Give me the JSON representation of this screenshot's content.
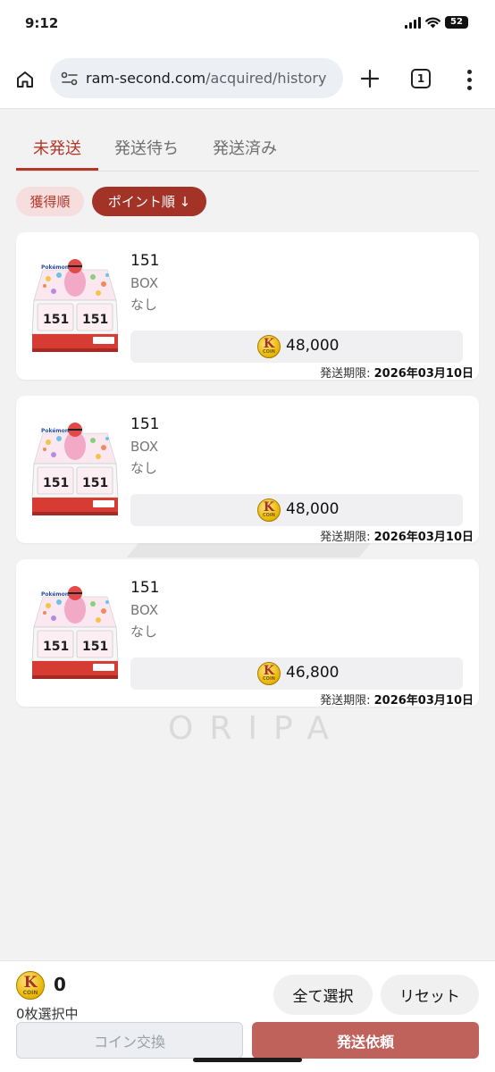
{
  "status_bar": {
    "time": "9:12",
    "battery": "52"
  },
  "browser": {
    "url_domain": "ram-second.com",
    "url_path": "/acquired/history",
    "tab_count": "1"
  },
  "tabs": [
    {
      "label": "未発送",
      "active": true
    },
    {
      "label": "発送待ち",
      "active": false
    },
    {
      "label": "発送済み",
      "active": false
    }
  ],
  "sort": {
    "acquired_label": "獲得順",
    "points_label": "ポイント順 ↓"
  },
  "coin_icon": {
    "letter": "K",
    "text": "COIN"
  },
  "items": [
    {
      "name": "151",
      "type": "BOX",
      "variant": "なし",
      "price": "48,000",
      "deadline_label": "発送期限:",
      "deadline_date": "2026年03月10日"
    },
    {
      "name": "151",
      "type": "BOX",
      "variant": "なし",
      "price": "48,000",
      "deadline_label": "発送期限:",
      "deadline_date": "2026年03月10日"
    },
    {
      "name": "151",
      "type": "BOX",
      "variant": "なし",
      "price": "46,800",
      "deadline_label": "発送期限:",
      "deadline_date": "2026年03月10日"
    }
  ],
  "watermark": "ORIPA",
  "bottom": {
    "coin_count": "0",
    "selected_text": "0枚選択中",
    "select_all_label": "全て選択",
    "reset_label": "リセット",
    "exchange_label": "コイン交換",
    "ship_label": "発送依頼"
  },
  "colors": {
    "accent": "#b4382a",
    "chip_active": "#a33227",
    "ship_button": "#c0625c"
  }
}
